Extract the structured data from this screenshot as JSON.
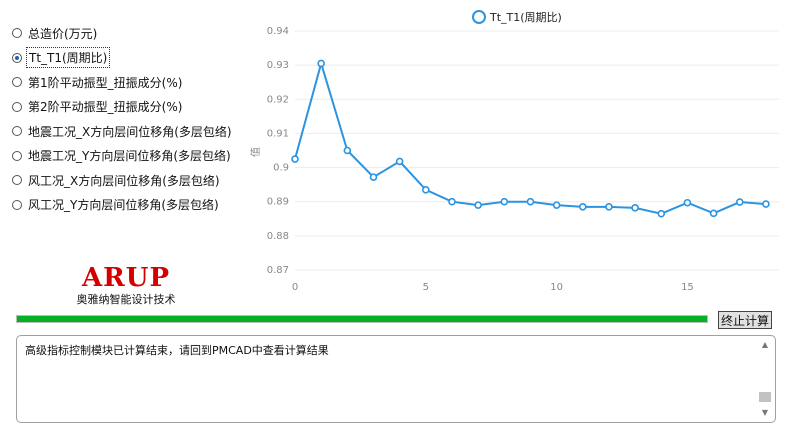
{
  "options": [
    {
      "label": "总造价(万元)",
      "checked": false
    },
    {
      "label": "Tt_T1(周期比)",
      "checked": true
    },
    {
      "label": "第1阶平动振型_扭振成分(%)",
      "checked": false
    },
    {
      "label": "第2阶平动振型_扭振成分(%)",
      "checked": false
    },
    {
      "label": "地震工况_X方向层间位移角(多层包络)",
      "checked": false
    },
    {
      "label": "地震工况_Y方向层间位移角(多层包络)",
      "checked": false
    },
    {
      "label": "风工况_X方向层间位移角(多层包络)",
      "checked": false
    },
    {
      "label": "风工况_Y方向层间位移角(多层包络)",
      "checked": false
    }
  ],
  "logo": {
    "main": "ARUP",
    "sub": "奥雅纳智能设计技术"
  },
  "progress_value": 1.0,
  "stop_button": "终止计算",
  "log_text": "高级指标控制模块已计算结束，请回到PMCAD中查看计算结果",
  "colors": {
    "series": "#2b94e1",
    "progress": "#06b025",
    "logo": "#d40000"
  },
  "chart_data": {
    "type": "line",
    "series": [
      {
        "name": "Tt_T1(周期比)",
        "x": [
          0,
          1,
          2,
          3,
          4,
          5,
          6,
          7,
          8,
          9,
          10,
          11,
          12,
          13,
          14,
          15,
          16,
          17,
          18
        ],
        "y": [
          0.9025,
          0.9305,
          0.905,
          0.8972,
          0.9018,
          0.8935,
          0.89,
          0.889,
          0.89,
          0.89,
          0.889,
          0.8885,
          0.8885,
          0.8882,
          0.8865,
          0.8897,
          0.8866,
          0.8899,
          0.8893
        ]
      }
    ],
    "ylabel": "值",
    "xlim": [
      0,
      18.5
    ],
    "ylim": [
      0.87,
      0.94
    ],
    "xticks": [
      0,
      5,
      10,
      15
    ],
    "yticks": [
      0.87,
      0.88,
      0.89,
      0.9,
      0.91,
      0.92,
      0.93,
      0.94
    ],
    "grid": true,
    "legend": "top"
  }
}
